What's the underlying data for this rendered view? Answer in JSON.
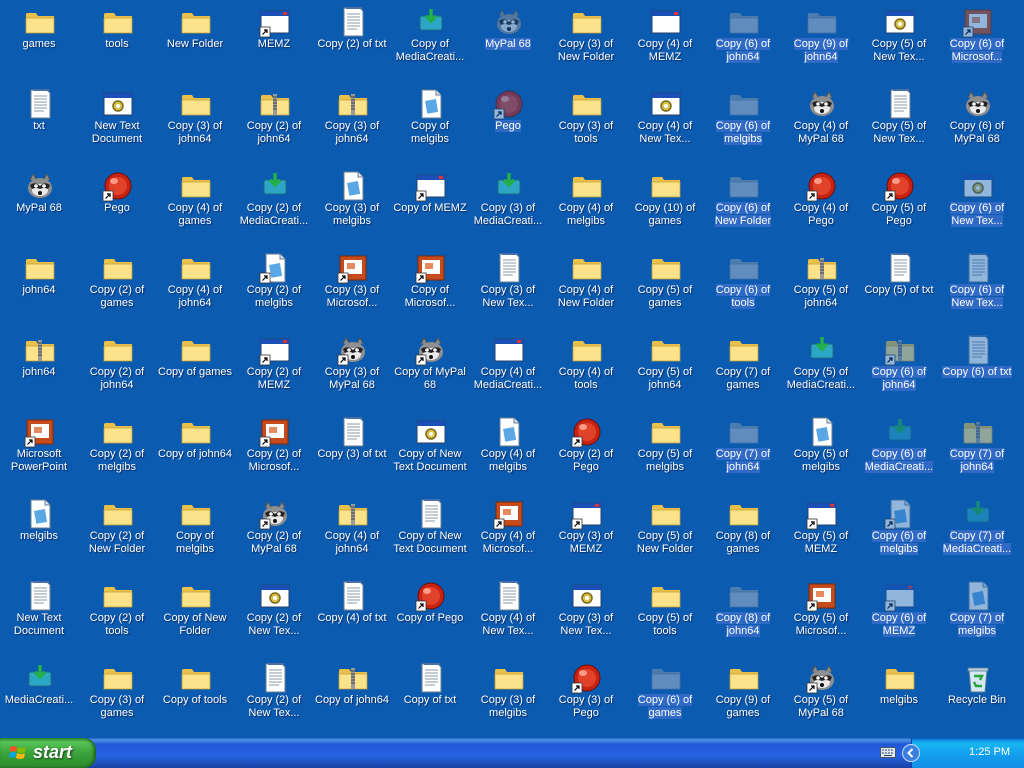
{
  "taskbar": {
    "start_label": "start",
    "clock": "1:25 PM"
  },
  "columns": [
    [
      {
        "label": "games",
        "icon": "folder"
      },
      {
        "label": "txt",
        "icon": "txt"
      },
      {
        "label": "MyPal 68",
        "icon": "raccoon"
      },
      {
        "label": "john64",
        "icon": "folder"
      },
      {
        "label": "john64",
        "icon": "zip"
      },
      {
        "label": "Microsoft PowerPoint",
        "icon": "ppt-sc"
      },
      {
        "label": "melgibs",
        "icon": "img"
      },
      {
        "label": "New Text Document",
        "icon": "txt"
      },
      {
        "label": "MediaCreati...",
        "icon": "media"
      }
    ],
    [
      {
        "label": "tools",
        "icon": "folder"
      },
      {
        "label": "New Text Document",
        "icon": "win-gear"
      },
      {
        "label": "Pego",
        "icon": "pego-sc"
      },
      {
        "label": "Copy (2) of games",
        "icon": "folder"
      },
      {
        "label": "Copy (2) of john64",
        "icon": "folder"
      },
      {
        "label": "Copy (2) of melgibs",
        "icon": "folder"
      },
      {
        "label": "Copy (2) of New Folder",
        "icon": "folder"
      },
      {
        "label": "Copy (2) of tools",
        "icon": "folder"
      },
      {
        "label": "Copy (3) of games",
        "icon": "folder"
      }
    ],
    [
      {
        "label": "New Folder",
        "icon": "folder"
      },
      {
        "label": "Copy (3) of john64",
        "icon": "folder"
      },
      {
        "label": "Copy (4) of games",
        "icon": "folder"
      },
      {
        "label": "Copy (4) of john64",
        "icon": "folder"
      },
      {
        "label": "Copy of games",
        "icon": "folder"
      },
      {
        "label": "Copy of john64",
        "icon": "folder"
      },
      {
        "label": "Copy of melgibs",
        "icon": "folder"
      },
      {
        "label": "Copy of New Folder",
        "icon": "folder"
      },
      {
        "label": "Copy of tools",
        "icon": "folder"
      }
    ],
    [
      {
        "label": "MEMZ",
        "icon": "win-sc"
      },
      {
        "label": "Copy (2) of john64",
        "icon": "zip"
      },
      {
        "label": "Copy (2) of MediaCreati...",
        "icon": "media"
      },
      {
        "label": "Copy (2) of melgibs",
        "icon": "img-sc"
      },
      {
        "label": "Copy (2) of MEMZ",
        "icon": "win-sc"
      },
      {
        "label": "Copy (2) of Microsof...",
        "icon": "ppt-sc"
      },
      {
        "label": "Copy (2) of MyPal 68",
        "icon": "raccoon-sc"
      },
      {
        "label": "Copy (2) of New Tex...",
        "icon": "win-gear"
      },
      {
        "label": "Copy (2) of New Tex...",
        "icon": "txt"
      }
    ],
    [
      {
        "label": "Copy (2) of txt",
        "icon": "txt"
      },
      {
        "label": "Copy (3) of john64",
        "icon": "zip"
      },
      {
        "label": "Copy (3) of melgibs",
        "icon": "img"
      },
      {
        "label": "Copy (3) of Microsof...",
        "icon": "ppt-sc"
      },
      {
        "label": "Copy (3) of MyPal 68",
        "icon": "raccoon-sc"
      },
      {
        "label": "Copy (3) of txt",
        "icon": "txt"
      },
      {
        "label": "Copy (4) of john64",
        "icon": "zip"
      },
      {
        "label": "Copy (4) of txt",
        "icon": "txt"
      },
      {
        "label": "Copy of john64",
        "icon": "zip"
      }
    ],
    [
      {
        "label": "Copy of MediaCreati...",
        "icon": "media"
      },
      {
        "label": "Copy of melgibs",
        "icon": "img"
      },
      {
        "label": "Copy of MEMZ",
        "icon": "win-sc"
      },
      {
        "label": "Copy of Microsof...",
        "icon": "ppt-sc"
      },
      {
        "label": "Copy of MyPal 68",
        "icon": "raccoon-sc"
      },
      {
        "label": "Copy of New Text Document",
        "icon": "win-gear"
      },
      {
        "label": "Copy of New Text Document",
        "icon": "txt"
      },
      {
        "label": "Copy of Pego",
        "icon": "pego-sc"
      },
      {
        "label": "Copy of txt",
        "icon": "txt"
      }
    ],
    [
      {
        "label": "MyPal 68",
        "icon": "raccoon",
        "sel": true
      },
      {
        "label": "Pego",
        "icon": "pego-sc",
        "sel": true
      },
      {
        "label": "Copy (3) of MediaCreati...",
        "icon": "media"
      },
      {
        "label": "Copy (3) of New Tex...",
        "icon": "txt"
      },
      {
        "label": "Copy (4) of MediaCreati...",
        "icon": "win"
      },
      {
        "label": "Copy (4) of melgibs",
        "icon": "img"
      },
      {
        "label": "Copy (4) of Microsof...",
        "icon": "ppt-sc"
      },
      {
        "label": "Copy (4) of New Tex...",
        "icon": "txt"
      },
      {
        "label": "Copy (3) of melgibs",
        "icon": "folder"
      }
    ],
    [
      {
        "label": "Copy (3) of New Folder",
        "icon": "folder"
      },
      {
        "label": "Copy (3) of tools",
        "icon": "folder"
      },
      {
        "label": "Copy (4) of melgibs",
        "icon": "folder"
      },
      {
        "label": "Copy (4) of New Folder",
        "icon": "folder"
      },
      {
        "label": "Copy (4) of tools",
        "icon": "folder"
      },
      {
        "label": "Copy (2) of Pego",
        "icon": "pego-sc"
      },
      {
        "label": "Copy (3) of MEMZ",
        "icon": "win-sc"
      },
      {
        "label": "Copy (3) of New Tex...",
        "icon": "win-gear"
      },
      {
        "label": "Copy (3) of Pego",
        "icon": "pego-sc"
      }
    ],
    [
      {
        "label": "Copy (4) of MEMZ",
        "icon": "win"
      },
      {
        "label": "Copy (4) of New Tex...",
        "icon": "win-gear"
      },
      {
        "label": "Copy (10) of games",
        "icon": "folder"
      },
      {
        "label": "Copy (5) of games",
        "icon": "folder"
      },
      {
        "label": "Copy (5) of john64",
        "icon": "folder"
      },
      {
        "label": "Copy (5) of melgibs",
        "icon": "folder"
      },
      {
        "label": "Copy (5) of New Folder",
        "icon": "folder"
      },
      {
        "label": "Copy (5) of tools",
        "icon": "folder"
      },
      {
        "label": "Copy (6) of games",
        "icon": "folder-gray",
        "sel": true
      }
    ],
    [
      {
        "label": "Copy (6) of john64",
        "icon": "folder-gray",
        "sel": true
      },
      {
        "label": "Copy (6) of melgibs",
        "icon": "folder-gray",
        "sel": true
      },
      {
        "label": "Copy (6) of New Folder",
        "icon": "folder-gray",
        "sel": true
      },
      {
        "label": "Copy (6) of tools",
        "icon": "folder-gray",
        "sel": true
      },
      {
        "label": "Copy (7) of games",
        "icon": "folder"
      },
      {
        "label": "Copy (7) of john64",
        "icon": "folder-gray",
        "sel": true
      },
      {
        "label": "Copy (8) of games",
        "icon": "folder"
      },
      {
        "label": "Copy (8) of john64",
        "icon": "folder-gray",
        "sel": true
      },
      {
        "label": "Copy (9) of games",
        "icon": "folder"
      }
    ],
    [
      {
        "label": "Copy (9) of john64",
        "icon": "folder-gray",
        "sel": true
      },
      {
        "label": "Copy (4) of MyPal 68",
        "icon": "raccoon"
      },
      {
        "label": "Copy (4) of Pego",
        "icon": "pego-sc"
      },
      {
        "label": "Copy (5) of john64",
        "icon": "zip"
      },
      {
        "label": "Copy (5) of MediaCreati...",
        "icon": "media"
      },
      {
        "label": "Copy (5) of melgibs",
        "icon": "img"
      },
      {
        "label": "Copy (5) of MEMZ",
        "icon": "win-sc"
      },
      {
        "label": "Copy (5) of Microsof...",
        "icon": "ppt-sc"
      },
      {
        "label": "Copy (5) of MyPal 68",
        "icon": "raccoon-sc"
      }
    ],
    [
      {
        "label": "Copy (5) of New Tex...",
        "icon": "win-gear"
      },
      {
        "label": "Copy (5) of New Tex...",
        "icon": "txt"
      },
      {
        "label": "Copy (5) of Pego",
        "icon": "pego-sc"
      },
      {
        "label": "Copy (5) of txt",
        "icon": "txt"
      },
      {
        "label": "Copy (6) of john64",
        "icon": "zip-sc",
        "sel": true
      },
      {
        "label": "Copy (6) of MediaCreati...",
        "icon": "media",
        "sel": true
      },
      {
        "label": "Copy (6) of melgibs",
        "icon": "img-sc",
        "sel": true
      },
      {
        "label": "Copy (6) of MEMZ",
        "icon": "win-sc",
        "sel": true
      },
      {
        "label": "melgibs",
        "icon": "folder"
      }
    ],
    [
      {
        "label": "Copy (6) of Microsof...",
        "icon": "ppt-sc",
        "sel": true
      },
      {
        "label": "Copy (6) of MyPal 68",
        "icon": "raccoon"
      },
      {
        "label": "Copy (6) of New Tex...",
        "icon": "win-gear",
        "sel": true
      },
      {
        "label": "Copy (6) of New Tex...",
        "icon": "txt",
        "sel": true
      },
      {
        "label": "Copy (6) of txt",
        "icon": "txt",
        "sel": true
      },
      {
        "label": "Copy (7) of john64",
        "icon": "zip",
        "sel": true
      },
      {
        "label": "Copy (7) of MediaCreati...",
        "icon": "media",
        "sel": true
      },
      {
        "label": "Copy (7) of melgibs",
        "icon": "img",
        "sel": true
      },
      {
        "label": "Recycle Bin",
        "icon": "recycle"
      }
    ]
  ]
}
